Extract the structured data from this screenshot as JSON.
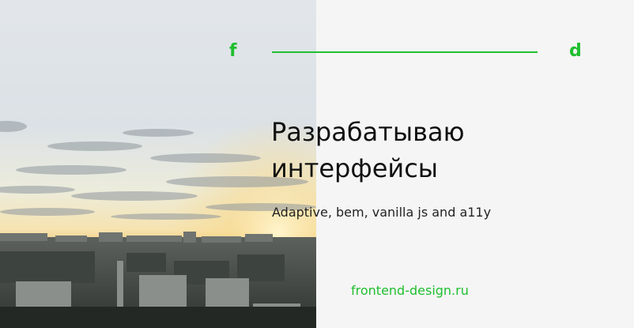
{
  "colors": {
    "accent": "#1fbf2f",
    "panel_background": "#f5f5f5",
    "headline": "#111111",
    "subtitle": "#222222"
  },
  "logo": {
    "left_letter": "f",
    "right_letter": "d"
  },
  "headline": {
    "line1": "Разрабатываю",
    "line2": "интерфейсы"
  },
  "subtitle": "Adaptive, bem, vanilla js and a11y",
  "site_link": "frontend-design.ru"
}
